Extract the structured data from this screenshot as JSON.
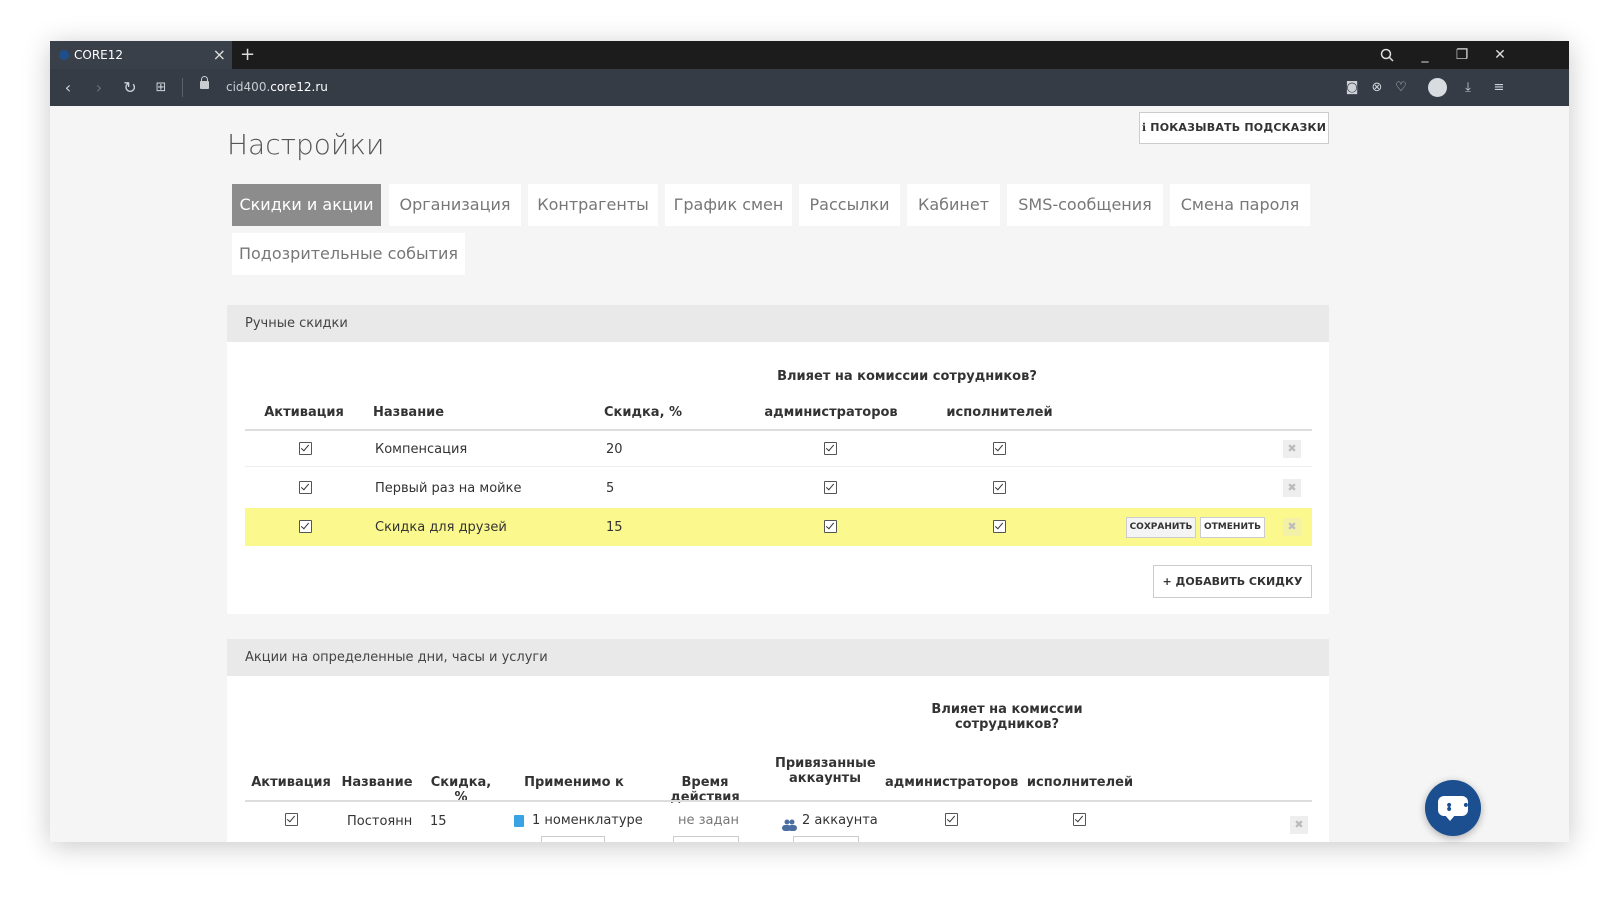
{
  "browser": {
    "tab_title": "CORE12",
    "new_tab": "+",
    "tab_close": "×",
    "url_prefix": "cid400.",
    "url_domain": "core12.ru"
  },
  "page": {
    "title": "Настройки",
    "hints_button": "ℹ ПОКАЗЫВАТЬ ПОДСКАЗКИ"
  },
  "settings_tabs": [
    {
      "label": "Скидки и акции",
      "active": true
    },
    {
      "label": "Организация"
    },
    {
      "label": "Контрагенты"
    },
    {
      "label": "График смен"
    },
    {
      "label": "Рассылки"
    },
    {
      "label": "Кабинет"
    },
    {
      "label": "SMS-сообщения"
    },
    {
      "label": "Смена пароля"
    },
    {
      "label": "Подозрительные события"
    }
  ],
  "manual_discounts": {
    "title": "Ручные скидки",
    "group_header": "Влияет на комиссии сотрудников?",
    "columns": [
      "Активация",
      "Название",
      "Скидка, %",
      "администраторов",
      "исполнителей"
    ],
    "rows": [
      {
        "active": true,
        "name": "Компенсация",
        "discount": "20",
        "admins": true,
        "executors": true
      },
      {
        "active": true,
        "name": "Первый раз на мойке",
        "discount": "5",
        "admins": true,
        "executors": true
      },
      {
        "active": true,
        "name": "Скидка для друзей",
        "discount": "15",
        "admins": true,
        "executors": true,
        "editing": true
      }
    ],
    "save_label": "СОХРАНИТЬ",
    "cancel_label": "ОТМЕНИТЬ",
    "add_label": "+ ДОБАВИТЬ СКИДКУ",
    "delete_glyph": "✖",
    "highlight_color": "#fbf98e"
  },
  "promotions": {
    "title": "Акции на определенные дни, часы и услуги",
    "group_header_line1": "Влияет на комиссии",
    "group_header_line2": "сотрудников?",
    "columns": [
      "Активация",
      "Название",
      "Скидка, %",
      "Применимо к",
      "Время действия",
      "Привязанные",
      "аккаунты",
      "администраторов",
      "исполнителей"
    ],
    "rows": [
      {
        "active": true,
        "name": "Постоянн",
        "discount": "15",
        "applies_to": "1 номенклатуре",
        "time": "не задан",
        "accounts": "2 аккаунта",
        "admins": true,
        "executors": true
      }
    ]
  },
  "icons": {
    "file": "file-icon",
    "users": "users-icon",
    "chat": "chat-icon"
  }
}
